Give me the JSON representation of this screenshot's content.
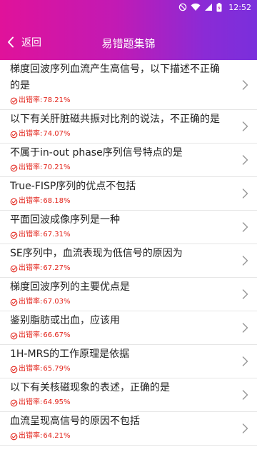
{
  "status_bar": {
    "time": "12:52"
  },
  "header": {
    "back_label": "返回",
    "title": "易错题集锦"
  },
  "error_rate_prefix": "出错率:",
  "questions": [
    {
      "text": "梯度回波序列血流产生高信号，以下描述不正确的是",
      "rate": "78.21%"
    },
    {
      "text": "以下有关肝脏磁共振对比剂的说法，不正确的是",
      "rate": "74.07%"
    },
    {
      "text": "不属于in-out phase序列信号特点的是",
      "rate": "70.21%"
    },
    {
      "text": "True-FISP序列的优点不包括",
      "rate": "68.18%"
    },
    {
      "text": "平面回波成像序列是一种",
      "rate": "67.31%"
    },
    {
      "text": "SE序列中，血流表现为低信号的原因为",
      "rate": "67.27%"
    },
    {
      "text": "梯度回波序列的主要优点是",
      "rate": "67.03%"
    },
    {
      "text": "鉴别脂肪或出血，应该用",
      "rate": "66.67%"
    },
    {
      "text": "1H-MRS的工作原理是依据",
      "rate": "65.79%"
    },
    {
      "text": "以下有关核磁现象的表述，正确的是",
      "rate": "64.95%"
    },
    {
      "text": "血流呈现高信号的原因不包括",
      "rate": "64.21%"
    }
  ]
}
